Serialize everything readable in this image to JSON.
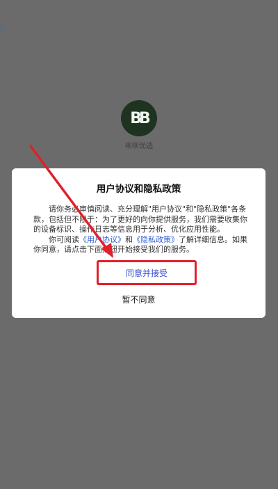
{
  "app": {
    "logo_text": "BB",
    "name": "呗呗优选"
  },
  "dialog": {
    "title": "用户协议和隐私政策",
    "para1": "请你务必审慎阅读、充分理解\"用户协议\"和\"隐私政策\"各条款，包括但不限于：为了更好的向你提供服务，我们需要收集你的设备标识、操作日志等信息用于分析、优化应用性能。",
    "para2_prefix": "你可阅读",
    "user_agreement_link": "《用户协议》",
    "para2_and": "和",
    "privacy_policy_link": "《隐私政策》",
    "para2_suffix": "了解详细信息。如果你同意，请点击下面按钮开始接受我们的服务。",
    "agree_label": "同意并接受",
    "decline_label": "暂不同意"
  },
  "annotation": {
    "color": "#e0202a"
  },
  "colors": {
    "overlay": "#6b6b6b",
    "link": "#2f5fd0",
    "highlight": "#e0202a"
  }
}
